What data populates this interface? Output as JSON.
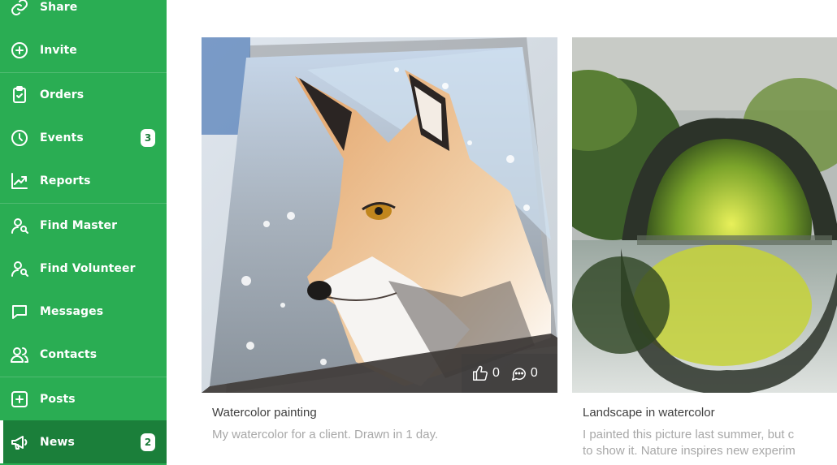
{
  "sidebar": {
    "items": [
      {
        "label": "Share",
        "icon": "link-icon",
        "badge": null
      },
      {
        "label": "Invite",
        "icon": "plus-circle-icon",
        "badge": null
      },
      {
        "label": "Orders",
        "icon": "clipboard-check-icon",
        "badge": null
      },
      {
        "label": "Events",
        "icon": "clock-icon",
        "badge": "3"
      },
      {
        "label": "Reports",
        "icon": "trending-up-icon",
        "badge": null
      },
      {
        "label": "Find Master",
        "icon": "user-search-icon",
        "badge": null
      },
      {
        "label": "Find Volunteer",
        "icon": "user-search-icon",
        "badge": null
      },
      {
        "label": "Messages",
        "icon": "chat-icon",
        "badge": null
      },
      {
        "label": "Contacts",
        "icon": "contacts-icon",
        "badge": null
      },
      {
        "label": "Posts",
        "icon": "plus-square-icon",
        "badge": null
      },
      {
        "label": "News",
        "icon": "megaphone-icon",
        "badge": "2",
        "active": true
      }
    ]
  },
  "posts": [
    {
      "title": "Watercolor painting",
      "description": "My watercolor for a client. Drawn in 1 day.",
      "likes": "0",
      "comments": "0",
      "image": "watercolor-fox-image"
    },
    {
      "title": "Landscape in watercolor",
      "description_line1": "I painted this picture last summer, but c",
      "description_line2": "to show it. Nature inspires new experim",
      "image": "watercolor-bridge-image"
    }
  ],
  "colors": {
    "sidebar_bg": "#2aad53",
    "sidebar_active": "#1b7f3a",
    "badge_text": "#1d7d3c",
    "title_text": "#3f3f3f",
    "desc_text": "#a8a8a8"
  }
}
